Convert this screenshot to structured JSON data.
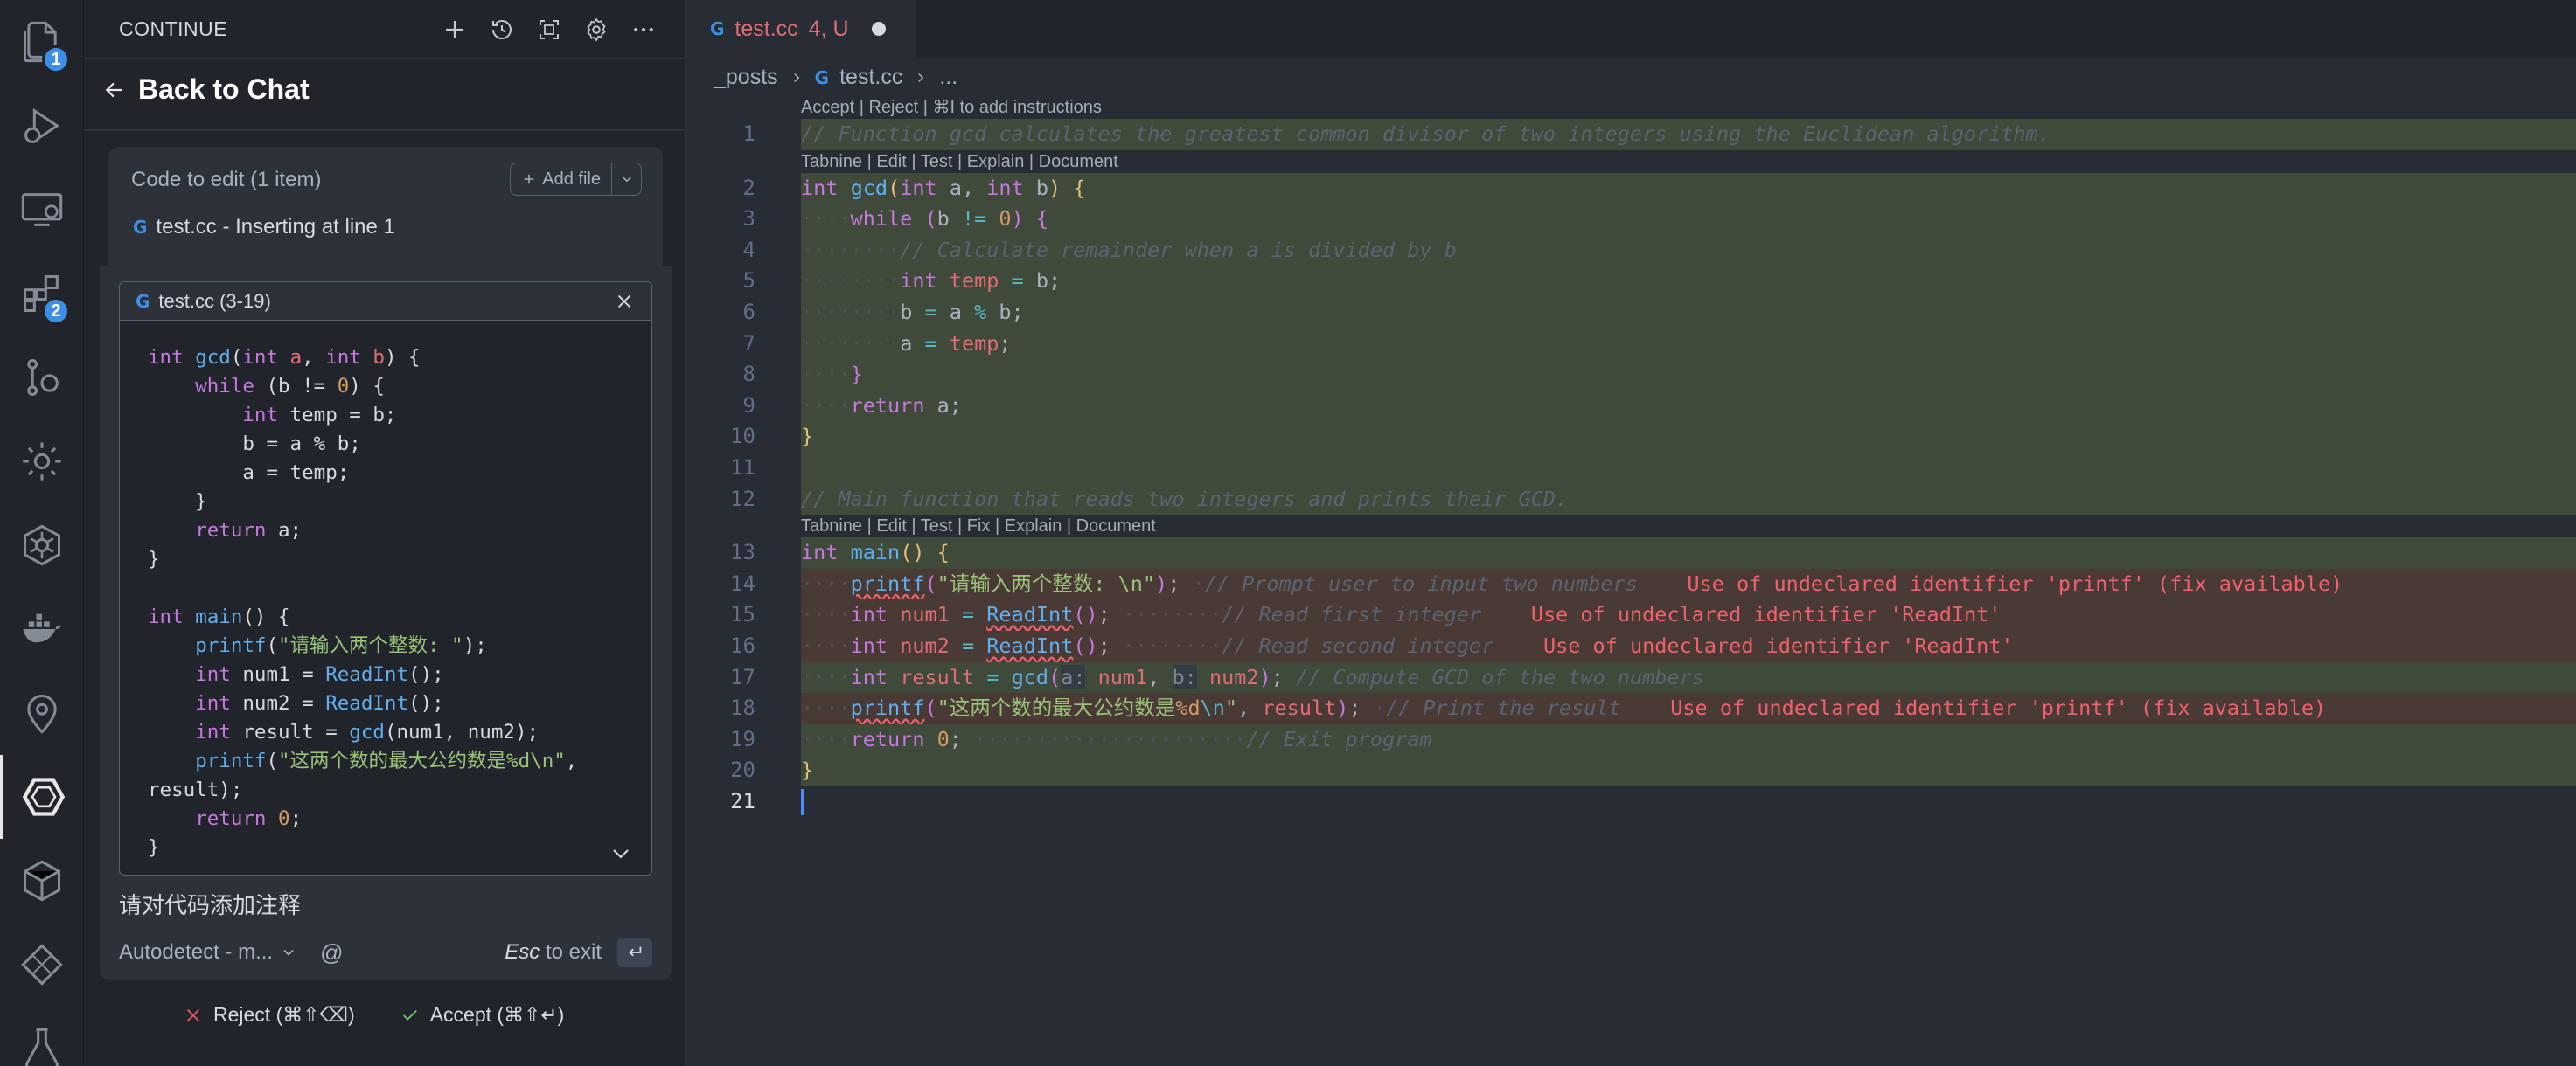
{
  "activity_bar": {
    "explorer_badge": "1",
    "extensions_badge": "2"
  },
  "sidebar": {
    "title": "CONTINUE",
    "back_label": "Back to Chat",
    "code_to_edit_label": "Code to edit (1 item)",
    "add_file_label": "Add file",
    "edit_file_item": "test.cc - Inserting at line 1",
    "snippet": {
      "title": "test.cc (3-19)",
      "lines": [
        "int gcd(int a, int b) {",
        "    while (b != 0) {",
        "        int temp = b;",
        "        b = a % b;",
        "        a = temp;",
        "    }",
        "    return a;",
        "}",
        "",
        "int main() {",
        "    printf(\"请输入两个整数: \");",
        "    int num1 = ReadInt();",
        "    int num2 = ReadInt();",
        "    int result = gcd(num1, num2);",
        "    printf(\"这两个数的最大公约数是%d\\n\",",
        "result);",
        "    return 0;",
        "}"
      ]
    },
    "prompt": "请对代码添加注释",
    "model_selector": "Autodetect - m...",
    "at_symbol": "@",
    "esc_key": "Esc",
    "esc_hint": "to exit",
    "reject_label": "Reject (⌘⇧⌫)",
    "accept_label": "Accept (⌘⇧↵)"
  },
  "editor": {
    "tab": {
      "name": "test.cc",
      "status": "4, U"
    },
    "breadcrumbs": [
      "_posts",
      "test.cc",
      "..."
    ],
    "code_lens": {
      "accept_reject": "Accept | Reject | ⌘I to add instructions",
      "tabnine_gcd": "Tabnine | Edit | Test | Explain | Document",
      "tabnine_main": "Tabnine | Edit | Test | Fix | Explain | Document"
    },
    "line_numbers": [
      "1",
      "2",
      "3",
      "4",
      "5",
      "6",
      "7",
      "8",
      "9",
      "10",
      "11",
      "12",
      "13",
      "14",
      "15",
      "16",
      "17",
      "18",
      "19",
      "20",
      "21"
    ],
    "errors": {
      "line14": "Use of undeclared identifier 'printf' (fix available)",
      "line15": "Use of undeclared identifier 'ReadInt'",
      "line16": "Use of undeclared identifier 'ReadInt'",
      "line18": "Use of undeclared identifier 'printf' (fix available)"
    }
  },
  "colors": {
    "accent": "#3d8fe6",
    "error": "#f0616d",
    "added_highlight": "#3f4a3a",
    "error_highlight": "#4a3a35"
  }
}
